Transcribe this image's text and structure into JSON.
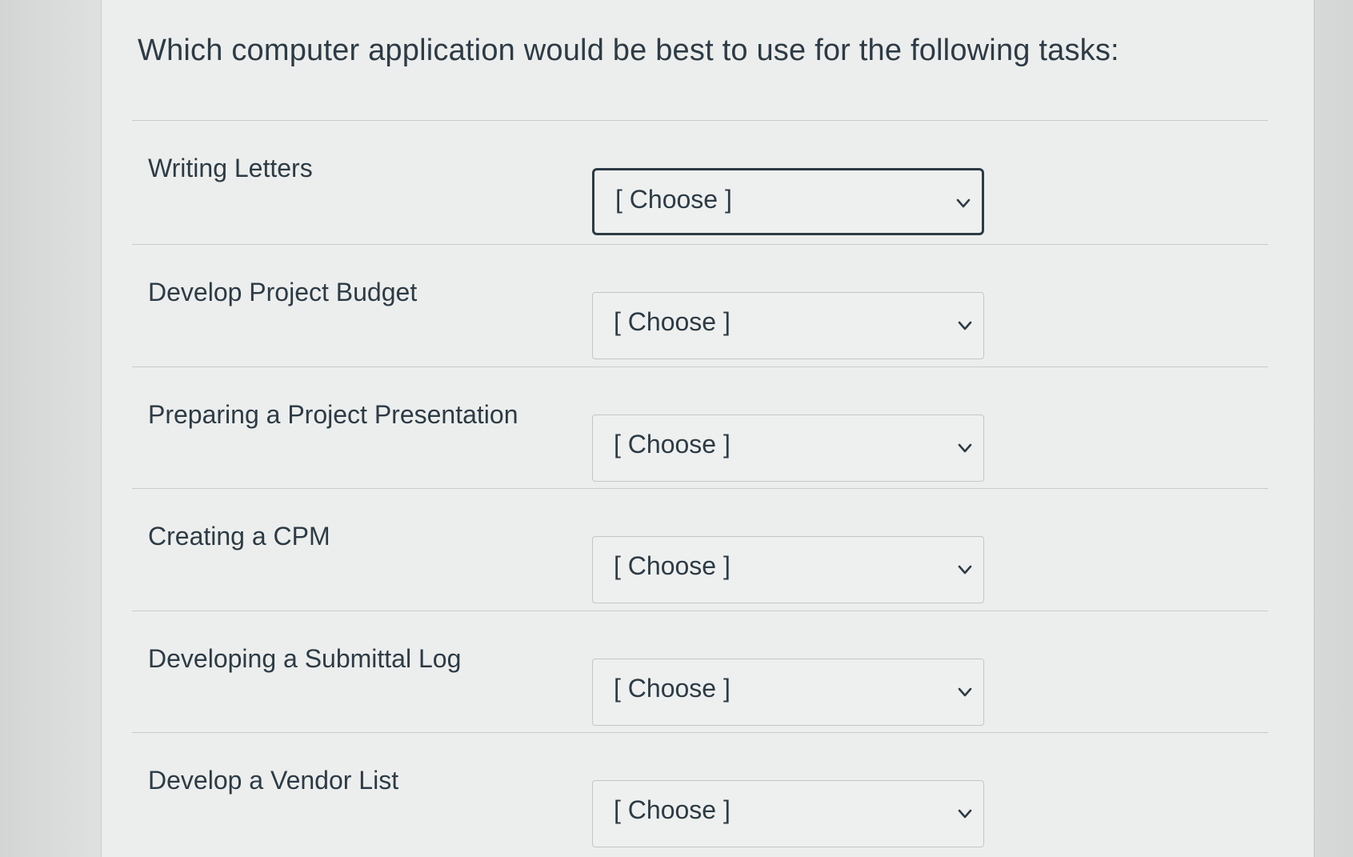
{
  "question": {
    "text": "Which computer application would be best to use for the following tasks:"
  },
  "rows": [
    {
      "label": "Writing Letters",
      "selected": "[ Choose ]"
    },
    {
      "label": "Develop Project Budget",
      "selected": "[ Choose ]"
    },
    {
      "label": "Preparing a Project Presentation",
      "selected": "[ Choose ]"
    },
    {
      "label": "Creating a CPM",
      "selected": "[ Choose ]"
    },
    {
      "label": "Developing a Submittal Log",
      "selected": "[ Choose ]"
    },
    {
      "label": "Develop a Vendor List",
      "selected": "[ Choose ]"
    }
  ],
  "icons": {
    "dropdown": "chevron-down-icon"
  },
  "colors": {
    "text": "#2d3b45",
    "focus_border": "#2d3b45",
    "field_border": "#c3c6c7"
  }
}
